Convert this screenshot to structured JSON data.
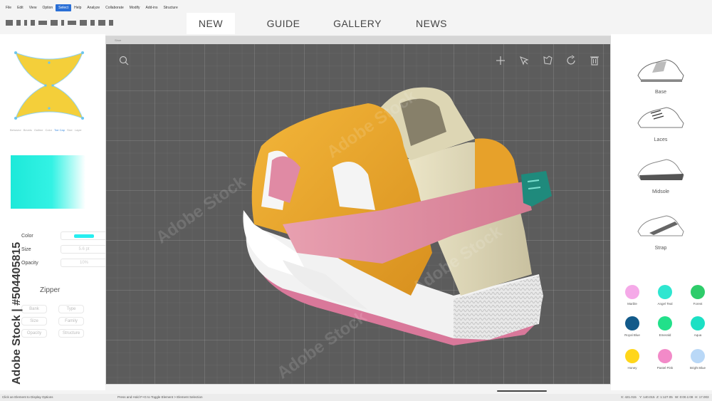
{
  "menu": [
    "File",
    "Edit",
    "View",
    "Option",
    "Select",
    "Help",
    "Analyze",
    "Collaborate",
    "Modify",
    "Add-ins",
    "Structure"
  ],
  "menu_active": "Select",
  "nav_tabs": [
    "NEW",
    "GUIDE",
    "GALLERY",
    "NEWS"
  ],
  "nav_active": "NEW",
  "left": {
    "shape_tabs": [
      "Behavior",
      "Bevels",
      "Outline",
      "Color",
      "Toe Cap",
      "Size",
      "Layer"
    ],
    "shape_tab_active": "Toe Cap",
    "props": [
      {
        "label": "Color",
        "value": ""
      },
      {
        "label": "Size",
        "value": "5.6 pt"
      },
      {
        "label": "Opacity",
        "value": "10%"
      }
    ],
    "color_swatch": "#28eef0",
    "zipper_title": "Zipper",
    "zipper_buttons": [
      "Bank",
      "Type",
      "Size",
      "Family",
      "Opacity",
      "Structure"
    ],
    "watermark": "Adobe Stock | #504405815"
  },
  "viewport": {
    "title": "Shoe",
    "tool_icons": [
      "search-icon",
      "add-icon",
      "pointer-icon",
      "shape-icon",
      "rotate-icon",
      "trash-icon"
    ],
    "watermark": "Adobe Stock"
  },
  "right": {
    "parts": [
      "Base",
      "Laces",
      "Midsole",
      "Strap"
    ],
    "materials": [
      {
        "name": "Marble",
        "color": "#f5a9e8"
      },
      {
        "name": "Angel Teal",
        "color": "#2ee6d0"
      },
      {
        "name": "Forest",
        "color": "#2ecc6a"
      },
      {
        "name": "Royal Blue",
        "color": "#125a8a"
      },
      {
        "name": "Emerald",
        "color": "#22e08a"
      },
      {
        "name": "Aqua",
        "color": "#1ce0c4"
      },
      {
        "name": "Honey",
        "color": "#ffd61a"
      },
      {
        "name": "Pastel Pink",
        "color": "#f28ac8"
      },
      {
        "name": "Bright Blue",
        "color": "#b9d8f7"
      }
    ]
  },
  "status": {
    "left": "Click an Element to Display Options",
    "middle": "Press and Hold F+G to Toggle Element > Element Selection",
    "r1": "X: 421.015",
    "r2": "Y: 140.015",
    "r3": "Z: 1:127.05",
    "r4": "W: 0:00.1:08",
    "r5": "H: 17.003"
  }
}
